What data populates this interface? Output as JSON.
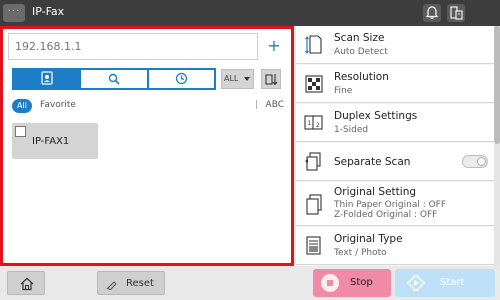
{
  "header": {
    "menu_label": "···",
    "title": "IP-Fax",
    "icons": [
      "bell-icon",
      "devices-icon"
    ]
  },
  "address": {
    "value": "",
    "placeholder": "192.168.1.1",
    "add_label": "+"
  },
  "view_tabs": [
    {
      "icon": "address-book-icon",
      "active": true
    },
    {
      "icon": "search-icon",
      "active": false
    },
    {
      "icon": "history-clock-icon",
      "active": false
    }
  ],
  "filter_dropdown": {
    "selected": "ALL"
  },
  "filter_row": {
    "all_label": "All",
    "favorite_label": "Favorite",
    "separator": "|",
    "abc_label": "ABC"
  },
  "destinations": [
    {
      "name": "IP-FAX1",
      "checked": false
    }
  ],
  "settings": [
    {
      "title": "Scan Size",
      "subtitle": "Auto Detect",
      "icon": "scan-size-icon"
    },
    {
      "title": "Resolution",
      "subtitle": "Fine",
      "icon": "resolution-icon"
    },
    {
      "title": "Duplex Settings",
      "subtitle": "1-Sided",
      "icon": "duplex-icon"
    },
    {
      "title": "Separate Scan",
      "subtitle": "",
      "icon": "separate-scan-icon",
      "toggle": false
    },
    {
      "title": "Original Setting",
      "subtitle": "Thin Paper Original : OFF",
      "subtitle2": "Z-Folded Original : OFF",
      "icon": "original-setting-icon"
    },
    {
      "title": "Original Type",
      "subtitle": "Text / Photo",
      "icon": "original-type-icon"
    }
  ],
  "bottom": {
    "reset_label": "Reset",
    "stop_label": "Stop",
    "start_label": "Start"
  },
  "colors": {
    "accent": "#1d7ec8",
    "highlight_border": "#e0131d",
    "stop": "#f08aa6",
    "start": "#bfe1f7"
  }
}
